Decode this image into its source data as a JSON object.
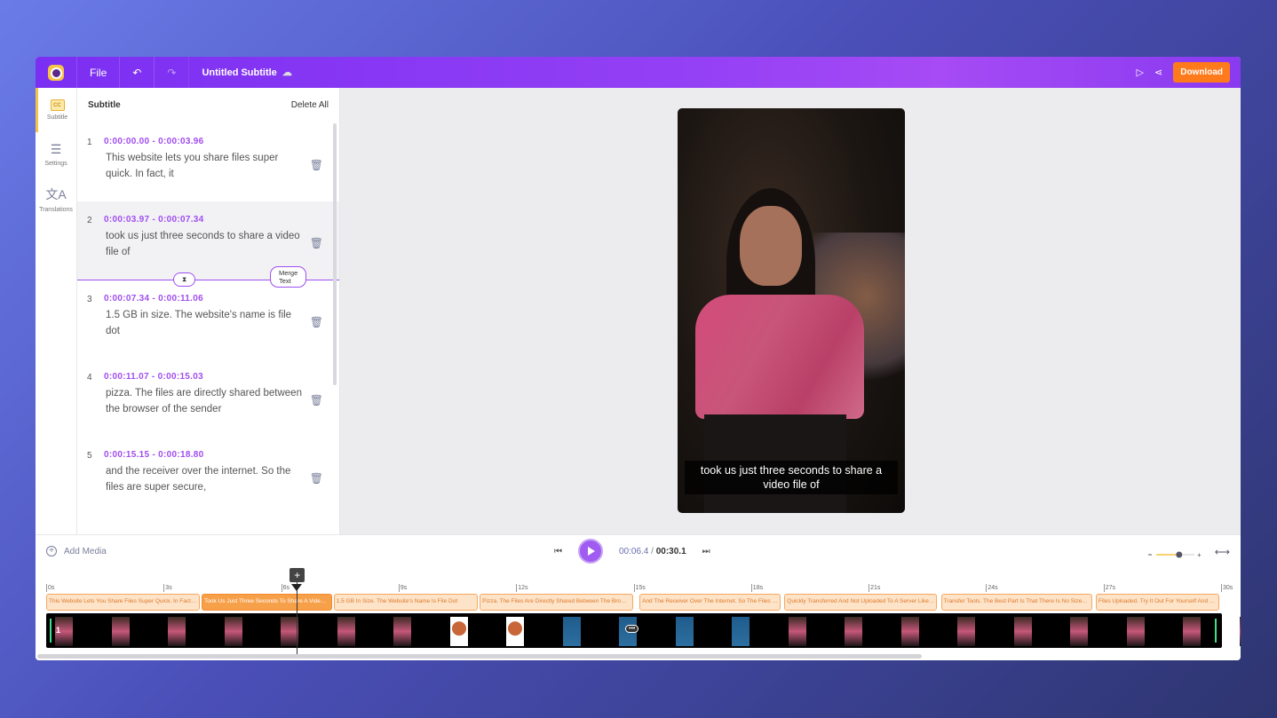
{
  "header": {
    "file": "File",
    "title": "Untitled Subtitle",
    "download": "Download",
    "icons": [
      "logo",
      "undo-icon",
      "redo-icon",
      "cloud-icon",
      "play-preview-icon",
      "share-icon"
    ]
  },
  "rail": [
    {
      "label": "Subtitle",
      "icon": "cc-icon"
    },
    {
      "label": "Settings",
      "icon": "sliders-icon"
    },
    {
      "label": "Translations",
      "icon": "translate-icon"
    }
  ],
  "panel": {
    "title": "Subtitle",
    "delete_all": "Delete All",
    "merge_label": "Merge Text",
    "segments": [
      {
        "num": "1",
        "time": "0:00:00.00 - 0:00:03.96",
        "text": "This website lets you share files super quick. In fact, it"
      },
      {
        "num": "2",
        "time": "0:00:03.97 - 0:00:07.34",
        "text": "took us just three seconds to share a video file of"
      },
      {
        "num": "3",
        "time": "0:00:07.34 - 0:00:11.06",
        "text": "1.5 GB in size. The website's name is file dot"
      },
      {
        "num": "4",
        "time": "0:00:11.07 - 0:00:15.03",
        "text": "pizza. The files are directly shared between the browser of the sender"
      },
      {
        "num": "5",
        "time": "0:00:15.15 - 0:00:18.80",
        "text": "and the receiver over the internet. So the files are super secure,"
      }
    ]
  },
  "preview": {
    "caption": "took us just three seconds to share a video file of"
  },
  "player": {
    "add_media": "Add Media",
    "current": "00:06.4",
    "separator": " / ",
    "total": "00:30.1",
    "zoom_level": 0.6
  },
  "timeline": {
    "ticks": [
      "0s",
      "3s",
      "6s",
      "9s",
      "12s",
      "15s",
      "18s",
      "21s",
      "24s",
      "27s",
      "30s"
    ],
    "clips": [
      {
        "start": 0,
        "end": 3.96,
        "text": "This Website Lets You Share Files Super Quick. In Fact, It"
      },
      {
        "start": 3.97,
        "end": 7.34,
        "text": "Took Us Just Three Seconds To Share A Video File Of"
      },
      {
        "start": 7.34,
        "end": 11.06,
        "text": "1.5 GB In Size. The Website's Name Is File Dot"
      },
      {
        "start": 11.07,
        "end": 15.03,
        "text": "Pizza. The Files Are Directly Shared Between The Browser Of The Sender"
      },
      {
        "start": 15.15,
        "end": 18.8,
        "text": "And The Receiver Over The Internet. So The Files Are Super Secure,"
      },
      {
        "start": 18.85,
        "end": 22.8,
        "text": "Quickly Transferred And Not Uploaded To A Server Like Other"
      },
      {
        "start": 22.85,
        "end": 26.75,
        "text": "Transfer Tools. The Best Part Is That There Is No Size Limit"
      },
      {
        "start": 26.8,
        "end": 30.1,
        "text": "Files Uploaded. Try It Out For Yourself And Let Me Know"
      }
    ],
    "selected_clip": 1,
    "playhead": 6.4,
    "duration": 30.1,
    "track_number": "1",
    "thumbs": [
      "person",
      "person",
      "person",
      "person",
      "person",
      "person",
      "person",
      "logo",
      "logo",
      "blue",
      "blue",
      "blue",
      "blue",
      "person",
      "person",
      "person",
      "person",
      "person",
      "person",
      "person",
      "person",
      "person"
    ]
  },
  "colors": {
    "accent": "#a04ef0",
    "download": "#ff7a1a",
    "clip": "#f7a04a"
  }
}
